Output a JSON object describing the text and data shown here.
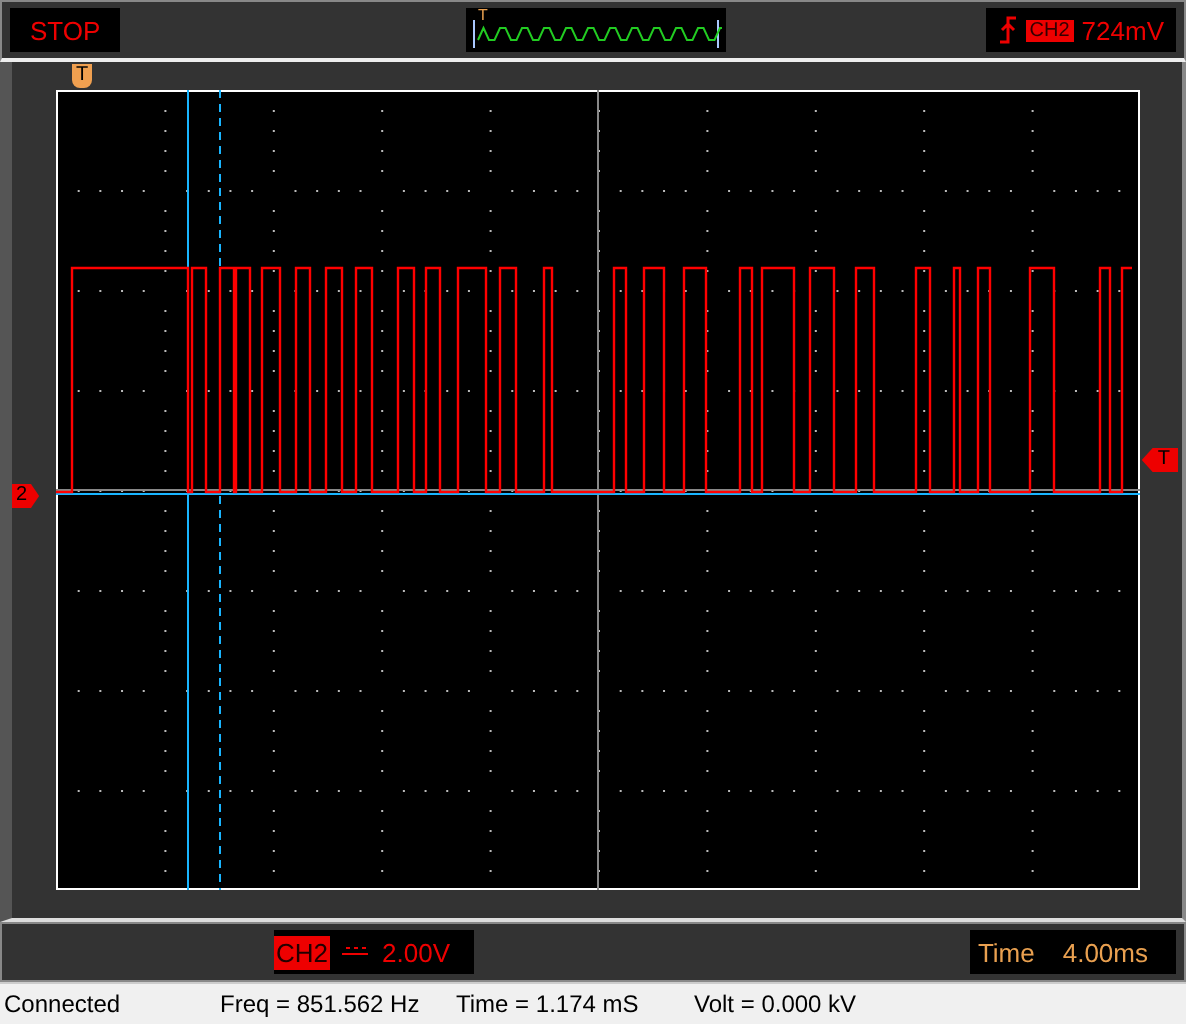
{
  "toolbar": {
    "run_state": "STOP",
    "preview_marker": "T",
    "trigger": {
      "channel": "CH2",
      "trigger_level": "724mV"
    }
  },
  "scope": {
    "trigger_marker": "T",
    "channel_marker": "2",
    "trigger_level_marker": "T"
  },
  "channel_info": {
    "channel": "CH2",
    "volts_per_div": "2.00V"
  },
  "timebase": {
    "label": "Time",
    "value": "4.00ms"
  },
  "status_bar": {
    "connection": "Connected",
    "frequency": "Freq = 851.562 Hz",
    "time": "Time = 1.174 mS",
    "volt": "Volt = 0.000 kV"
  }
}
